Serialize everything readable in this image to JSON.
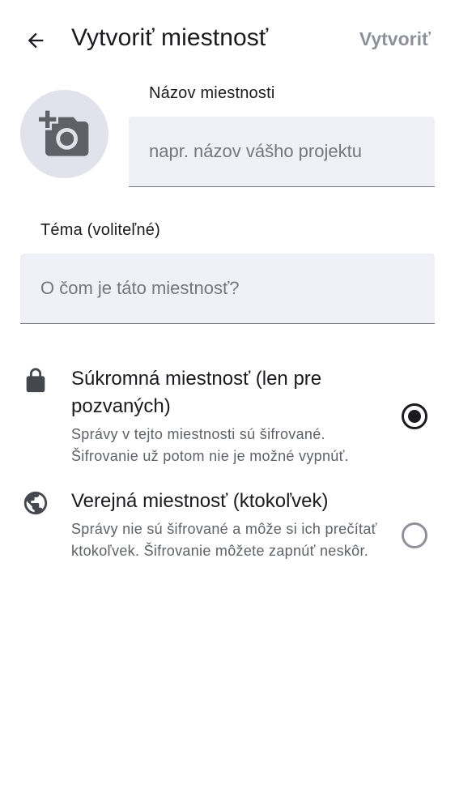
{
  "header": {
    "back_icon": "arrow-back-icon",
    "title": "Vytvoriť miestnosť",
    "create_label": "Vytvoriť"
  },
  "avatar": {
    "icon": "add-a-photo-icon"
  },
  "room_name": {
    "label": "Názov miestnosti",
    "value": "",
    "placeholder": "napr. názov vášho projektu"
  },
  "topic": {
    "label": "Téma (voliteľné)",
    "value": "",
    "placeholder": "O čom je táto miestnosť?"
  },
  "options": [
    {
      "icon": "lock-icon",
      "title": "Súkromná miestnosť (len pre pozvaných)",
      "description": "Správy v tejto miestnosti sú šifrované. Šifrovanie už potom nie je možné vypnúť.",
      "selected": true
    },
    {
      "icon": "globe-icon",
      "title": "Verejná miestnosť (ktokoľvek)",
      "description": "Správy nie sú šifrované a môže si ich prečítať ktokoľvek. Šifrovanie môžete zapnúť neskôr.",
      "selected": false
    }
  ],
  "colors": {
    "text_primary": "#1b1b1f",
    "text_secondary": "#5e6168",
    "action_disabled": "#8e9199",
    "field_bg": "#f0f1f7",
    "avatar_bg": "#e1e2ec"
  }
}
